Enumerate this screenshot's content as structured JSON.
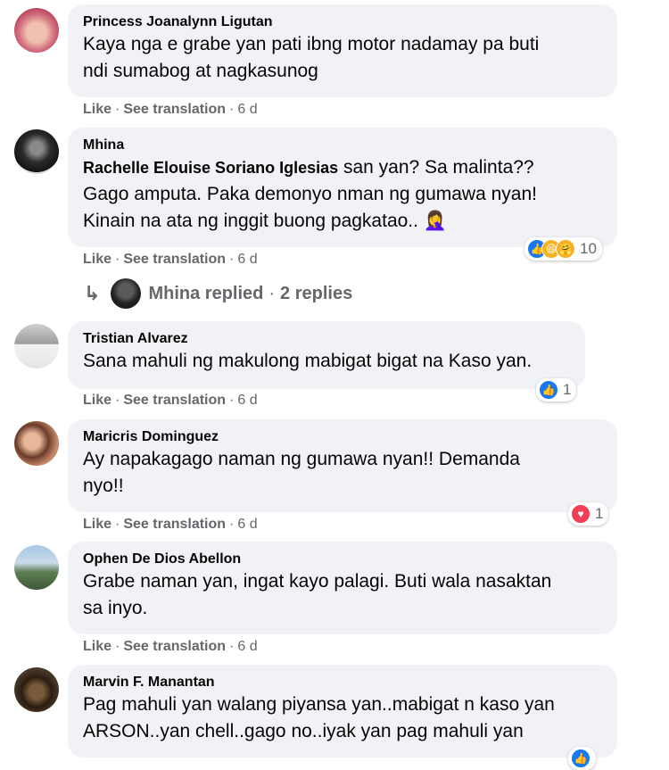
{
  "reply_thread": {
    "author": "Mhina",
    "replied": "replied",
    "dot": "·",
    "count": "2 replies"
  },
  "comments": [
    {
      "author": "Princess Joanalynn Ligutan",
      "mention": "",
      "lines": [
        "Kaya nga e grabe yan pati ibng motor nadamay pa buti",
        "ndi sumabog at nagkasunog"
      ],
      "like": "Like",
      "see_translation": "See translation",
      "time": "6 d",
      "reaction_count": ""
    },
    {
      "author": "Mhina",
      "mention": "Rachelle Elouise Soriano Iglesias",
      "lines": [
        "san yan? Sa malinta??",
        "Gago amputa. Paka demonyo nman ng gumawa nyan!",
        "Kinain na ata ng inggit buong pagkatao.. 🤦‍♀️"
      ],
      "like": "Like",
      "see_translation": "See translation",
      "time": "6 d",
      "reaction_count": "10"
    },
    {
      "author": "Tristian Alvarez",
      "mention": "",
      "lines": [
        "Sana mahuli ng makulong mabigat bigat na Kaso yan."
      ],
      "like": "Like",
      "see_translation": "See translation",
      "time": "6 d",
      "reaction_count": "1"
    },
    {
      "author": "Maricris Dominguez",
      "mention": "",
      "lines": [
        "Ay napakagago naman ng gumawa nyan!! Demanda",
        "nyo!!"
      ],
      "like": "Like",
      "see_translation": "See translation",
      "time": "6 d",
      "reaction_count": "1"
    },
    {
      "author": "Ophen De Dios Abellon",
      "mention": "",
      "lines": [
        "Grabe naman yan, ingat kayo palagi. Buti wala nasaktan",
        "sa inyo."
      ],
      "like": "Like",
      "see_translation": "See translation",
      "time": "6 d",
      "reaction_count": ""
    },
    {
      "author": "Marvin F. Manantan",
      "mention": "",
      "lines": [
        "Pag mahuli yan walang piyansa yan..mabigat n kaso yan",
        "ARSON..yan chell..gago no..iyak yan pag mahuli yan"
      ],
      "like": "",
      "see_translation": "",
      "time": "",
      "reaction_count": ""
    }
  ],
  "colors": {
    "bubble": "#f0f2f5",
    "meta": "#65676b",
    "like_blue": "#1877f2",
    "love_red": "#f33e58",
    "haha_yellow": "#f7b125"
  },
  "icons": {
    "reply_arrow": "reply-arrow-icon",
    "like": "like-reaction-icon",
    "haha": "haha-reaction-icon",
    "love": "love-reaction-icon",
    "care": "care-reaction-icon"
  }
}
